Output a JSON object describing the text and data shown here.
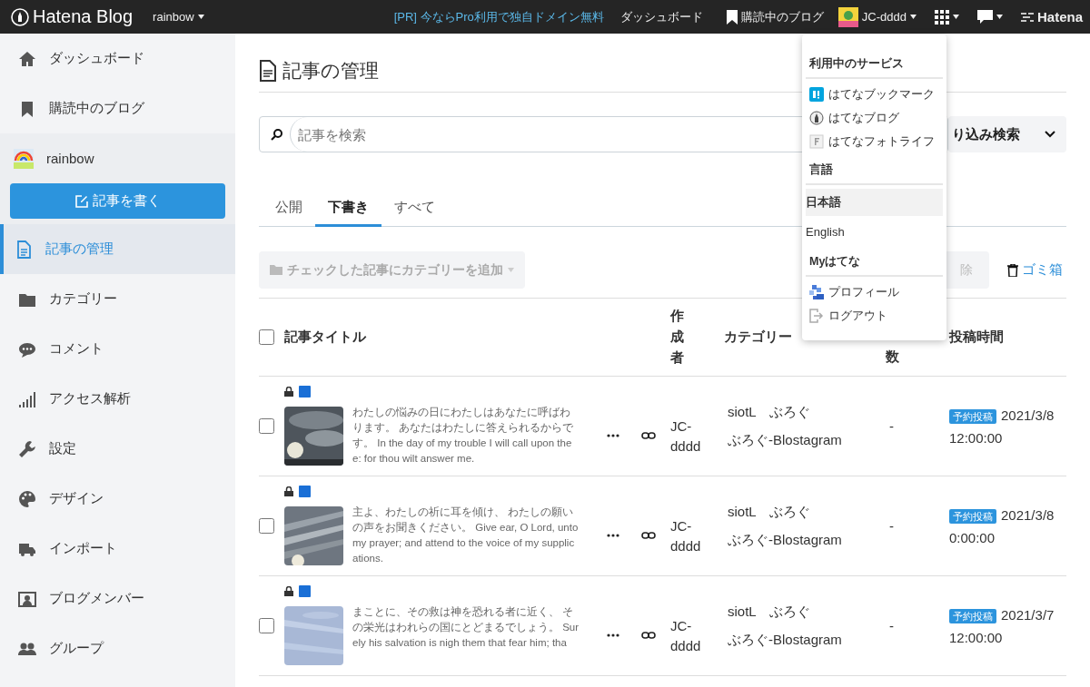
{
  "topbar": {
    "logo": "Hatena Blog",
    "blog_menu": "rainbow",
    "promo": "[PR] 今ならPro利用で独自ドメイン無料",
    "dashboard": "ダッシュボード",
    "subscriptions": "購読中のブログ",
    "user": "JC-dddd",
    "brand": "Hatena"
  },
  "sidebar": {
    "items": [
      {
        "kind": "nav",
        "label": "ダッシュボード",
        "selected": false
      },
      {
        "kind": "nav",
        "label": "購読中のブログ",
        "selected": false
      },
      {
        "kind": "blog",
        "label": "rainbow"
      },
      {
        "kind": "write",
        "label": "記事を書く"
      },
      {
        "kind": "nav",
        "label": "記事の管理",
        "selected": true
      },
      {
        "kind": "nav",
        "label": "カテゴリー",
        "selected": false
      },
      {
        "kind": "nav",
        "label": "コメント",
        "selected": false
      },
      {
        "kind": "nav",
        "label": "アクセス解析",
        "selected": false
      },
      {
        "kind": "nav",
        "label": "設定",
        "selected": false
      },
      {
        "kind": "nav",
        "label": "デザイン",
        "selected": false
      },
      {
        "kind": "nav",
        "label": "インポート",
        "selected": false
      },
      {
        "kind": "nav",
        "label": "ブログメンバー",
        "selected": false
      },
      {
        "kind": "nav",
        "label": "グループ",
        "selected": false
      }
    ]
  },
  "main": {
    "title": "記事の管理",
    "search": {
      "placeholder": "記事を検索"
    },
    "filter_button": "り込み検索",
    "tabs": [
      {
        "label": "公開",
        "selected": false
      },
      {
        "label": "下書き",
        "selected": true
      },
      {
        "label": "すべて",
        "selected": false
      }
    ],
    "bulk_button": {
      "label": "チェックした記事にカテゴリーを追加",
      "disabled": true
    },
    "delete_button": {
      "label": "除",
      "disabled": true
    },
    "trash_link": "ゴミ箱",
    "table": {
      "select_all_checked": false,
      "columns": [
        "記事タイトル",
        "作成者",
        "カテゴリー",
        "数",
        "投稿時間"
      ],
      "rows": [
        {
          "checked": false,
          "excerpt": "わたしの悩みの日にわたしはあなたに呼ばわります。 あなたはわたしに答えられるからです。 In the day of my trouble I will call upon thee: for thou wilt answer me.",
          "author": "JC-dddd",
          "categories": [
            "siotL　ぶろぐ",
            "ぶろぐ-Blostagram"
          ],
          "comments": "-",
          "status": "予約投稿",
          "date": "2021/3/8 12:00:00"
        },
        {
          "checked": false,
          "excerpt": "主よ、わたしの祈に耳を傾け、 わたしの願いの声をお聞きください。 Give ear, O Lord, unto my prayer; and attend to the voice of my supplications.",
          "author": "JC-dddd",
          "categories": [
            "siotL　ぶろぐ",
            "ぶろぐ-Blostagram"
          ],
          "comments": "-",
          "status": "予約投稿",
          "date": "2021/3/8 0:00:00"
        },
        {
          "checked": false,
          "excerpt": "まことに、その救は神を恐れる者に近く、 その栄光はわれらの国にとどまるでしょう。 Surely his salvation is nigh them that fear him; tha",
          "author": "JC-dddd",
          "categories": [
            "siotL　ぶろぐ",
            "ぶろぐ-Blostagram"
          ],
          "comments": "-",
          "status": "予約投稿",
          "date": "2021/3/7 12:00:00"
        }
      ]
    }
  },
  "menu": {
    "sections": [
      {
        "heading": "利用中のサービス",
        "items": [
          {
            "label": "はてなブックマーク"
          },
          {
            "label": "はてなブログ"
          },
          {
            "label": "はてなフォトライフ"
          }
        ]
      },
      {
        "heading": "言語",
        "items": [
          {
            "label": "日本語",
            "selected": true
          },
          {
            "label": "English",
            "selected": false
          }
        ]
      },
      {
        "heading": "Myはてな",
        "items": [
          {
            "label": "プロフィール"
          },
          {
            "label": "ログアウト"
          }
        ]
      }
    ]
  }
}
